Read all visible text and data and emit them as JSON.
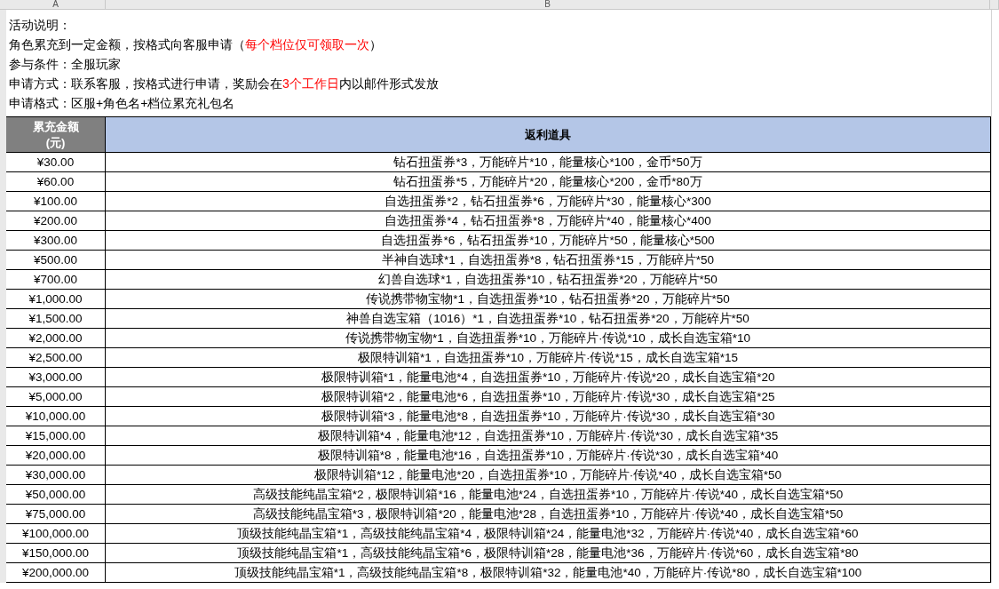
{
  "column_headers": [
    "A",
    "B"
  ],
  "intro": [
    [
      {
        "text": "活动说明：",
        "highlight": false
      }
    ],
    [
      {
        "text": "角色累充到一定金额，按格式向客服申请（",
        "highlight": false
      },
      {
        "text": "每个档位仅可领取一次",
        "highlight": true
      },
      {
        "text": "）",
        "highlight": false
      }
    ],
    [
      {
        "text": "参与条件：全服玩家",
        "highlight": false
      }
    ],
    [
      {
        "text": "申请方式：联系客服，按格式进行申请，奖励会在",
        "highlight": false
      },
      {
        "text": "3个工作日",
        "highlight": true
      },
      {
        "text": "内以邮件形式发放",
        "highlight": false
      }
    ],
    [
      {
        "text": "申请格式：区服+角色名+档位累充礼包名",
        "highlight": false
      }
    ]
  ],
  "table": {
    "columns": [
      "累充金额\n(元)",
      "返利道具"
    ],
    "rows": [
      [
        "¥30.00",
        "钻石扭蛋券*3，万能碎片*10，能量核心*100，金币*50万"
      ],
      [
        "¥60.00",
        "钻石扭蛋券*5，万能碎片*20，能量核心*200，金币*80万"
      ],
      [
        "¥100.00",
        "自选扭蛋券*2，钻石扭蛋券*6，万能碎片*30，能量核心*300"
      ],
      [
        "¥200.00",
        "自选扭蛋券*4，钻石扭蛋券*8，万能碎片*40，能量核心*400"
      ],
      [
        "¥300.00",
        "自选扭蛋券*6，钻石扭蛋券*10，万能碎片*50，能量核心*500"
      ],
      [
        "¥500.00",
        "半神自选球*1，自选扭蛋券*8，钻石扭蛋券*15，万能碎片*50"
      ],
      [
        "¥700.00",
        "幻兽自选球*1，自选扭蛋券*10，钻石扭蛋券*20，万能碎片*50"
      ],
      [
        "¥1,000.00",
        "传说携带物宝物*1，自选扭蛋券*10，钻石扭蛋券*20，万能碎片*50"
      ],
      [
        "¥1,500.00",
        "神兽自选宝箱（1016）*1，自选扭蛋券*10，钻石扭蛋券*20，万能碎片*50"
      ],
      [
        "¥2,000.00",
        "传说携带物宝物*1，自选扭蛋券*10，万能碎片·传说*10，成长自选宝箱*10"
      ],
      [
        "¥2,500.00",
        "极限特训箱*1，自选扭蛋券*10，万能碎片·传说*15，成长自选宝箱*15"
      ],
      [
        "¥3,000.00",
        "极限特训箱*1，能量电池*4，自选扭蛋券*10，万能碎片·传说*20，成长自选宝箱*20"
      ],
      [
        "¥5,000.00",
        "极限特训箱*2，能量电池*6，自选扭蛋券*10，万能碎片·传说*30，成长自选宝箱*25"
      ],
      [
        "¥10,000.00",
        "极限特训箱*3，能量电池*8，自选扭蛋券*10，万能碎片·传说*30，成长自选宝箱*30"
      ],
      [
        "¥15,000.00",
        "极限特训箱*4，能量电池*12，自选扭蛋券*10，万能碎片·传说*30，成长自选宝箱*35"
      ],
      [
        "¥20,000.00",
        "极限特训箱*8，能量电池*16，自选扭蛋券*10，万能碎片·传说*30，成长自选宝箱*40"
      ],
      [
        "¥30,000.00",
        "极限特训箱*12，能量电池*20，自选扭蛋券*10，万能碎片·传说*40，成长自选宝箱*50"
      ],
      [
        "¥50,000.00",
        "高级技能纯晶宝箱*2，极限特训箱*16，能量电池*24，自选扭蛋券*10，万能碎片·传说*40，成长自选宝箱*50"
      ],
      [
        "¥75,000.00",
        "高级技能纯晶宝箱*3，极限特训箱*20，能量电池*28，自选扭蛋券*10，万能碎片·传说*40，成长自选宝箱*50"
      ],
      [
        "¥100,000.00",
        "顶级技能纯晶宝箱*1，高级技能纯晶宝箱*4，极限特训箱*24，能量电池*32，万能碎片·传说*40，成长自选宝箱*60"
      ],
      [
        "¥150,000.00",
        "顶级技能纯晶宝箱*1，高级技能纯晶宝箱*6，极限特训箱*28，能量电池*36，万能碎片·传说*60，成长自选宝箱*80"
      ],
      [
        "¥200,000.00",
        "顶级技能纯晶宝箱*1，高级技能纯晶宝箱*8，极限特训箱*32，能量电池*40，万能碎片·传说*80，成长自选宝箱*100"
      ]
    ]
  }
}
